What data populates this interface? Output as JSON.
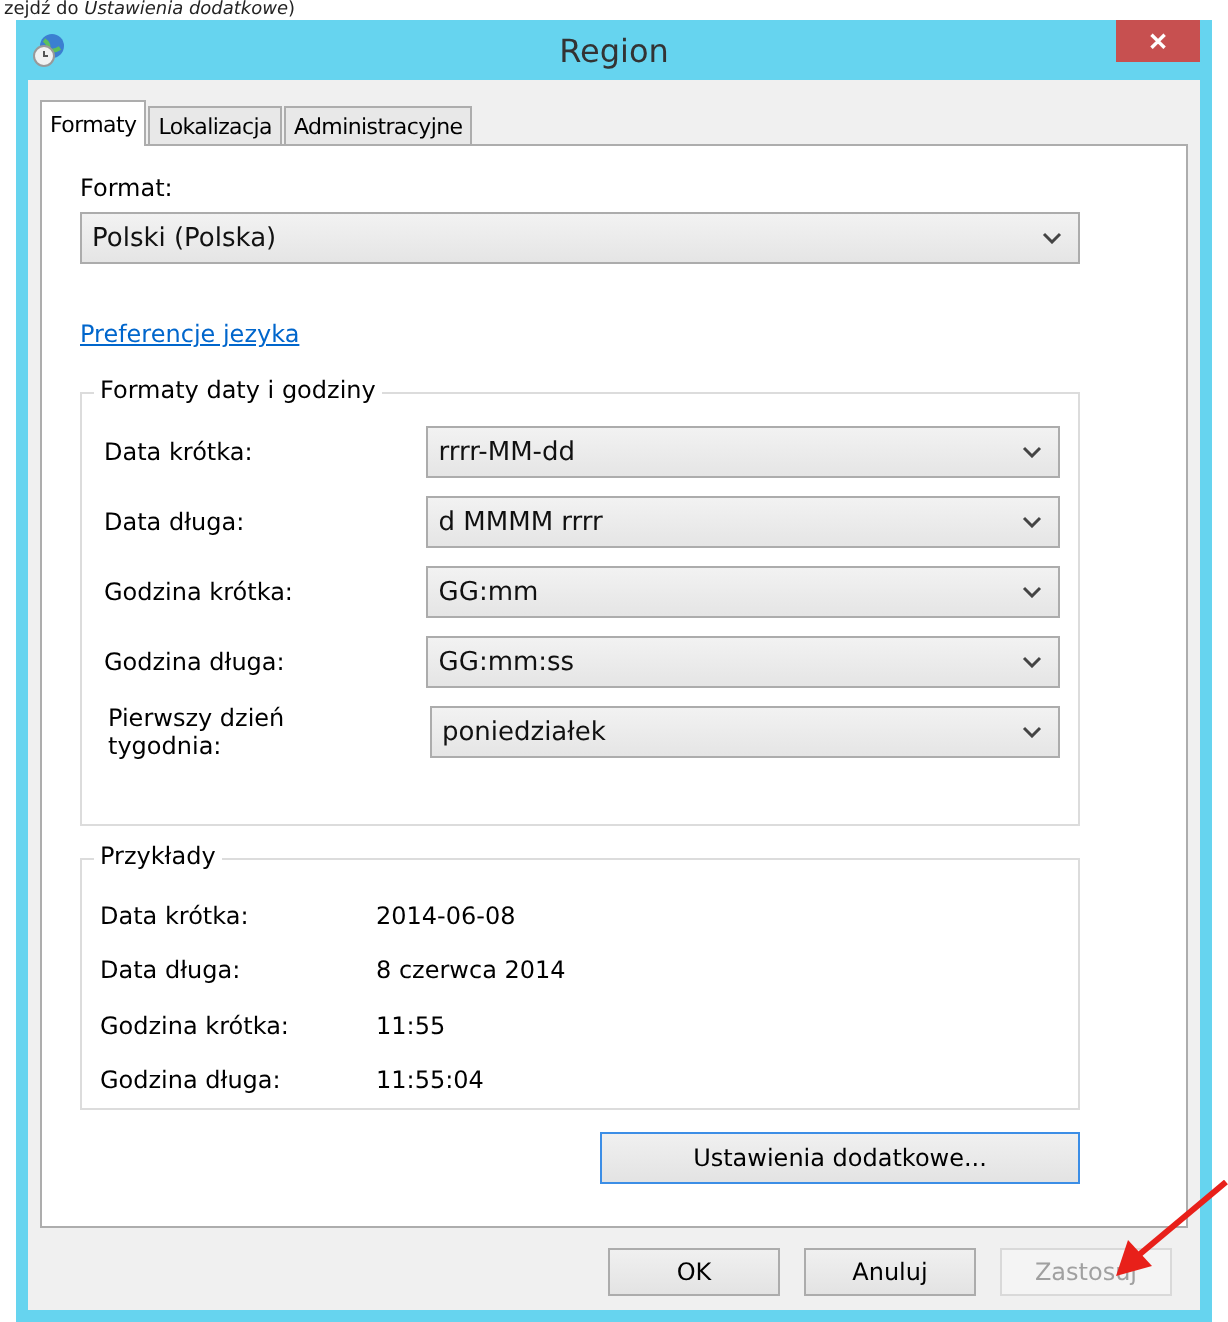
{
  "caption": "zejdź do *Ustawienia dodatkowe*)",
  "window": {
    "title": "Region",
    "close": "✕"
  },
  "tabs": [
    {
      "label": "Formaty",
      "selected": true
    },
    {
      "label": "Lokalizacja",
      "selected": false
    },
    {
      "label": "Administracyjne",
      "selected": false
    }
  ],
  "format": {
    "label": "Format:",
    "value": "Polski (Polska)"
  },
  "language_link": "Preferencje jezyka",
  "date_time_formats": {
    "title": "Formaty daty i godziny",
    "rows": [
      {
        "label": "Data krótka:",
        "value": "rrrr-MM-dd"
      },
      {
        "label": "Data długa:",
        "value": "d MMMM rrrr"
      },
      {
        "label": "Godzina krótka:",
        "value": "GG:mm"
      },
      {
        "label": "Godzina długa:",
        "value": "GG:mm:ss"
      },
      {
        "label": "Pierwszy dzień tygodnia:",
        "value": "poniedziałek"
      }
    ]
  },
  "examples": {
    "title": "Przykłady",
    "rows": [
      {
        "label": "Data krótka:",
        "value": "2014-06-08"
      },
      {
        "label": "Data długa:",
        "value": "8 czerwca 2014"
      },
      {
        "label": "Godzina krótka:",
        "value": "11:55"
      },
      {
        "label": "Godzina długa:",
        "value": "11:55:04"
      }
    ]
  },
  "additional_button": {
    "label": "Ustawienia dodatkowe...",
    "focused": true
  },
  "buttons": [
    {
      "label": "OK",
      "disabled": false
    },
    {
      "label": "Anuluj",
      "disabled": false
    },
    {
      "label": "Zastosuj",
      "disabled": true
    }
  ]
}
